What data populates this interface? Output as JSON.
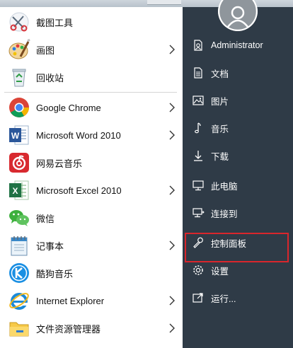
{
  "left_items": [
    {
      "label": "截图工具",
      "icon": "snipping-tool-icon",
      "has_arrow": false
    },
    {
      "label": "画图",
      "icon": "paint-icon",
      "has_arrow": true
    },
    {
      "label": "回收站",
      "icon": "recycle-bin-icon",
      "has_arrow": false
    },
    {
      "label": "Google Chrome",
      "icon": "chrome-icon",
      "has_arrow": true
    },
    {
      "label": "Microsoft Word 2010",
      "icon": "word-icon",
      "has_arrow": true
    },
    {
      "label": "网易云音乐",
      "icon": "netease-music-icon",
      "has_arrow": false
    },
    {
      "label": "Microsoft Excel 2010",
      "icon": "excel-icon",
      "has_arrow": true
    },
    {
      "label": "微信",
      "icon": "wechat-icon",
      "has_arrow": false
    },
    {
      "label": "记事本",
      "icon": "notepad-icon",
      "has_arrow": true
    },
    {
      "label": "酷狗音乐",
      "icon": "kugou-icon",
      "has_arrow": false
    },
    {
      "label": "Internet Explorer",
      "icon": "internet-explorer-icon",
      "has_arrow": true
    },
    {
      "label": "文件资源管理器",
      "icon": "file-explorer-icon",
      "has_arrow": true
    }
  ],
  "right_items": [
    {
      "label": "Administrator",
      "icon": "user-account-icon"
    },
    {
      "label": "文档",
      "icon": "documents-icon"
    },
    {
      "label": "图片",
      "icon": "pictures-icon"
    },
    {
      "label": "音乐",
      "icon": "music-icon"
    },
    {
      "label": "下载",
      "icon": "download-icon"
    },
    {
      "label": "此电脑",
      "icon": "this-pc-icon"
    },
    {
      "label": "连接到",
      "icon": "connect-to-icon"
    },
    {
      "label": "控制面板",
      "icon": "control-panel-icon",
      "highlighted": true
    },
    {
      "label": "设置",
      "icon": "settings-icon"
    },
    {
      "label": "运行...",
      "icon": "run-icon"
    }
  ],
  "colors": {
    "right_panel_bg": "#2f3b47",
    "highlight_border": "#d9262c",
    "left_panel_bg": "#ffffff"
  }
}
